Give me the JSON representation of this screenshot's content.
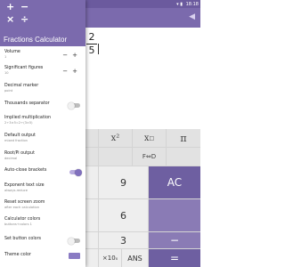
{
  "status": {
    "time": "18:18",
    "signal": "▾ ▮"
  },
  "calculator": {
    "back_icon": "◀",
    "numerator": "2",
    "denominator": "5",
    "keys": {
      "square": "x²",
      "power": "x",
      "power_sup": "□",
      "pi": "π",
      "f_to_d": "F⇔D",
      "nine": "9",
      "six": "6",
      "three": "3",
      "ac": "AC",
      "minus": "−",
      "times_ten": "×10",
      "times_ten_sup": "x",
      "ans": "ANS",
      "equals": "="
    }
  },
  "drawer": {
    "logo": {
      "plus": "+",
      "minus": "−",
      "times": "×",
      "divide": "÷"
    },
    "title": "Fractions Calculator",
    "settings": [
      {
        "label": "Volume",
        "value": "1",
        "control": "stepper"
      },
      {
        "label": "Significant figures",
        "value": "10",
        "control": "stepper"
      },
      {
        "label": "Decimal marker",
        "value": "point",
        "control": "none"
      },
      {
        "label": "Thousands separator",
        "value": "",
        "control": "toggle-off"
      },
      {
        "label": "Implied multiplication",
        "value": "2÷3×5=2÷(3×5)",
        "control": "none"
      },
      {
        "label": "Default output",
        "value": "mixed fraction",
        "control": "none"
      },
      {
        "label": "Root/Pi output",
        "value": "decimal",
        "control": "none"
      },
      {
        "label": "Auto-close brackets",
        "value": "",
        "control": "toggle-on"
      },
      {
        "label": "Exponent text size",
        "value": "always-reduce",
        "control": "none"
      },
      {
        "label": "Reset screen zoom",
        "value": "after each calculation",
        "control": "none"
      },
      {
        "label": "Calculator colors",
        "value": "buttons+colors 1",
        "control": "none"
      },
      {
        "label": "Set button colors",
        "value": "",
        "control": "toggle-off"
      },
      {
        "label": "Theme color",
        "value": "",
        "control": "swatch"
      }
    ],
    "stepper_minus": "−",
    "stepper_plus": "+",
    "theme_color": "#8a7bc3"
  }
}
